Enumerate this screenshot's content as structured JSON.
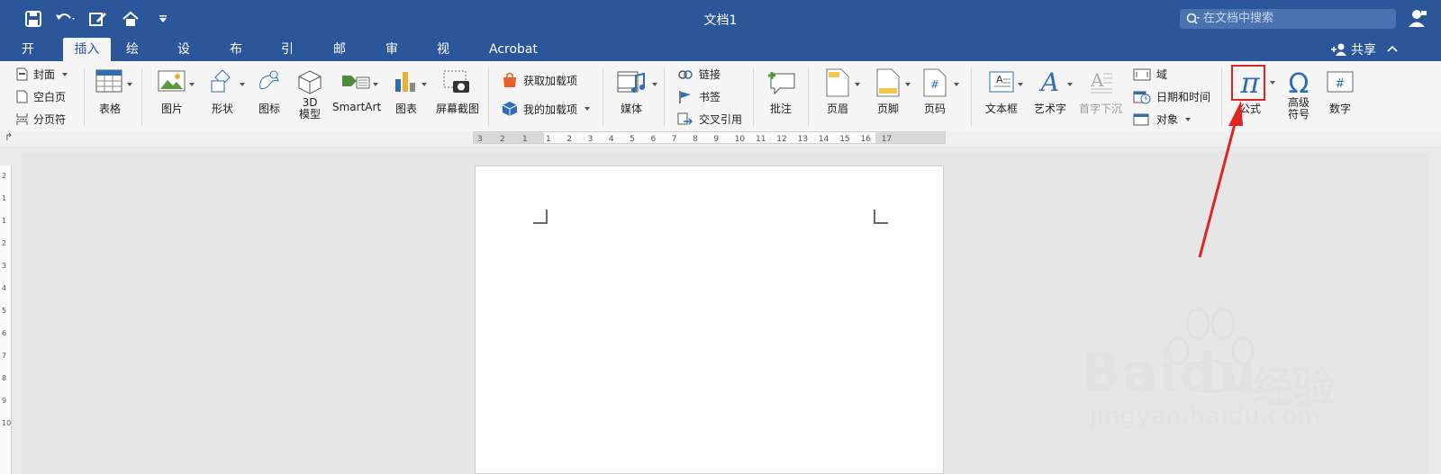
{
  "window": {
    "title": "文档1",
    "search_placeholder": "在文档中搜索"
  },
  "quick_access": [
    "save-icon",
    "undo-icon",
    "edit-icon",
    "home-icon",
    "customize-icon"
  ],
  "tabs": [
    "开始",
    "插入",
    "绘图",
    "设计",
    "布局",
    "引用",
    "邮件",
    "审阅",
    "视图",
    "Acrobat"
  ],
  "active_tab": "插入",
  "share_label": "共享",
  "pages_group": {
    "cover": "封面",
    "blank": "空白页",
    "break": "分页符"
  },
  "ribbon": {
    "table": "表格",
    "picture": "图片",
    "shape": "形状",
    "icon": "图标",
    "model3d": "3D\n模型",
    "smartart": "SmartArt",
    "chart": "图表",
    "screenshot": "屏幕截图",
    "get_addins": "获取加载项",
    "my_addins": "我的加载项",
    "media": "媒体",
    "link": "链接",
    "bookmark": "书签",
    "crossref": "交叉引用",
    "comment": "批注",
    "header": "页眉",
    "footer": "页脚",
    "pagenum": "页码",
    "textbox": "文本框",
    "wordart": "艺术字",
    "dropcap": "首字下沉",
    "field": "域",
    "datetime": "日期和时间",
    "object": "对象",
    "equation": "公式",
    "symbol": "高级\n符号",
    "number": "数字"
  },
  "ruler": {
    "top_ticks": [
      "3",
      "2",
      "1",
      "1",
      "2",
      "3",
      "4",
      "5",
      "6",
      "7",
      "8",
      "9",
      "10",
      "11",
      "12",
      "13",
      "14",
      "15",
      "16",
      "17"
    ],
    "left_ticks": [
      "2",
      "1",
      "1",
      "2",
      "3",
      "4",
      "5",
      "6",
      "7",
      "8",
      "9",
      "10"
    ]
  },
  "watermark": {
    "brand": "Baidu",
    "cn": "经验",
    "url": "jingyan.baidu.com"
  },
  "colors": {
    "accent": "#2b579a",
    "highlight": "#e02424",
    "pi": "#2f6db5"
  }
}
